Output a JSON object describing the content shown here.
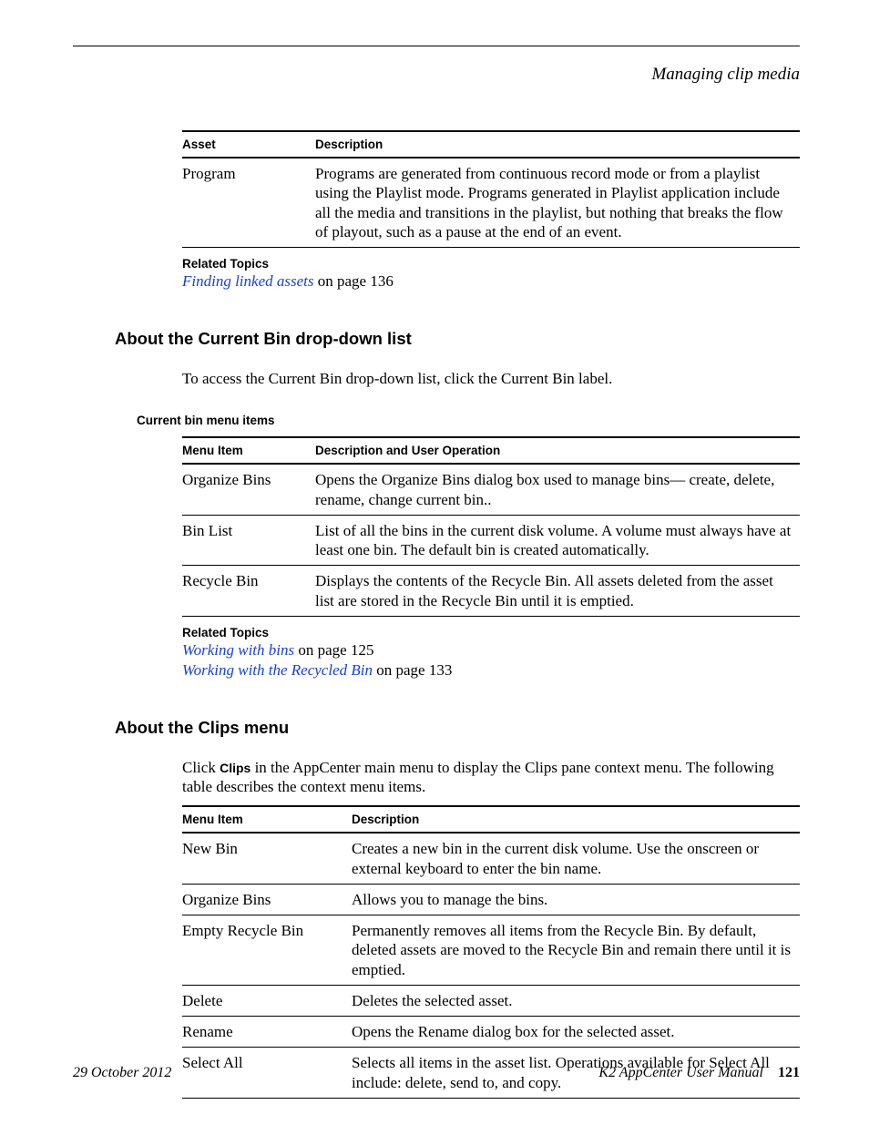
{
  "running_head": "Managing clip media",
  "table1": {
    "headers": [
      "Asset",
      "Description"
    ],
    "rows": [
      {
        "c1": "Program",
        "c2": "Programs are generated from continuous record mode or from a playlist using the Playlist mode. Programs generated in Playlist application include all the media and transitions in the playlist, but nothing that breaks the flow of playout, such as a pause at the end of an event."
      }
    ]
  },
  "related1": {
    "heading": "Related Topics",
    "items": [
      {
        "link": "Finding linked assets",
        "suffix": " on page 136"
      }
    ]
  },
  "section1": {
    "title": "About the Current Bin drop-down list",
    "intro": "To access the Current Bin drop-down list, click the Current Bin label.",
    "subheading": "Current bin menu items"
  },
  "table2": {
    "headers": [
      "Menu Item",
      "Description and User Operation"
    ],
    "rows": [
      {
        "c1": "Organize Bins",
        "c2": "Opens the Organize Bins dialog box used to manage bins— create, delete, rename, change current bin.."
      },
      {
        "c1": "Bin List",
        "c2": "List of all the bins in the current disk volume. A volume must always have at least one bin. The default bin is created automatically."
      },
      {
        "c1": "Recycle Bin",
        "c2": "Displays the contents of the Recycle Bin. All assets deleted from the asset list are stored in the Recycle Bin until it is emptied."
      }
    ]
  },
  "related2": {
    "heading": "Related Topics",
    "items": [
      {
        "link": "Working with bins",
        "suffix": " on page 125"
      },
      {
        "link": "Working with the Recycled Bin",
        "suffix": " on page 133"
      }
    ]
  },
  "section2": {
    "title": "About the Clips menu",
    "intro_pre": "Click ",
    "intro_bold": "Clips",
    "intro_post": " in the AppCenter main menu to display the Clips pane context menu. The following table describes the context menu items."
  },
  "table3": {
    "headers": [
      "Menu Item",
      "Description"
    ],
    "rows": [
      {
        "c1": "New Bin",
        "c2": "Creates a new bin in the current disk volume. Use the onscreen or external keyboard to enter the bin name."
      },
      {
        "c1": "Organize Bins",
        "c2": "Allows you to manage the bins."
      },
      {
        "c1": "Empty Recycle Bin",
        "c2": "Permanently removes all items from the Recycle Bin. By default, deleted assets are moved to the Recycle Bin and remain there until it is emptied."
      },
      {
        "c1": "Delete",
        "c2": "Deletes the selected asset."
      },
      {
        "c1": "Rename",
        "c2": "Opens the Rename dialog box for the selected asset."
      },
      {
        "c1": "Select All",
        "c2": "Selects all items in the asset list. Operations available for Select All include: delete, send to, and copy."
      }
    ]
  },
  "footer": {
    "left": "29 October 2012",
    "right_title": "K2 AppCenter User Manual",
    "page": "121"
  }
}
